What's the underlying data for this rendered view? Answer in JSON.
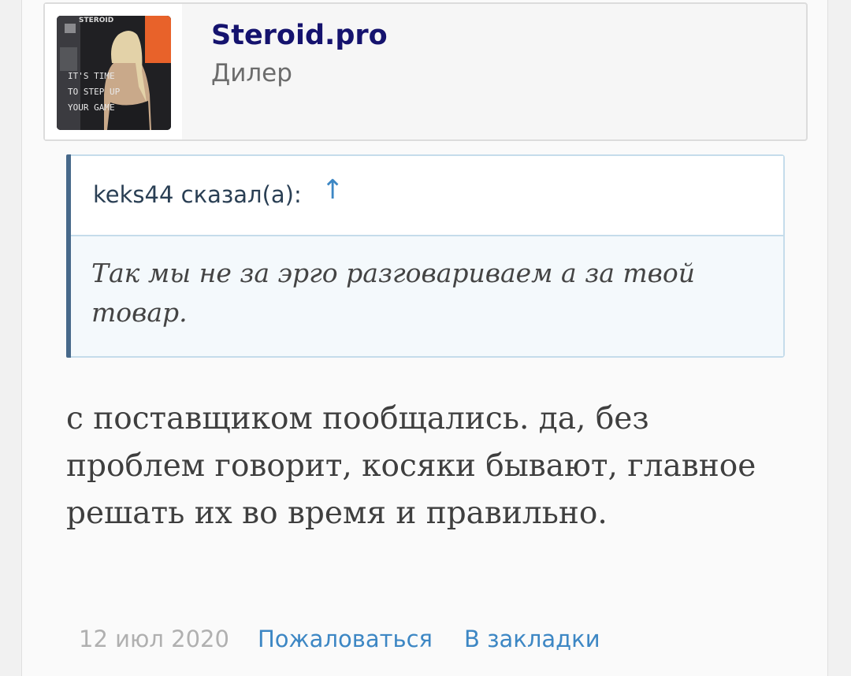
{
  "user": {
    "name": "Steroid.pro",
    "title": "Дилер",
    "avatar": {
      "logo_text": "STEROID",
      "slogan_lines": [
        "IT'S TIME",
        "TO STEP UP",
        "YOUR GAME"
      ],
      "accent_color": "#e8622a"
    }
  },
  "quote": {
    "author_label": "keks44 сказал(а):",
    "arrow_icon": "↑",
    "text": "Так мы не за эрго разговариваем а за твой товар."
  },
  "message": {
    "text": "с поставщиком пообщались. да, без проблем говорит, косяки бывают, главное решать их во время и правильно."
  },
  "footer": {
    "date": "12 июл 2020",
    "report_label": "Пожаловаться",
    "bookmark_label": "В закладки"
  },
  "colors": {
    "username": "#15136e",
    "link": "#3d87c4",
    "quote_bar": "#47698a",
    "quote_border": "#c5dceb"
  }
}
